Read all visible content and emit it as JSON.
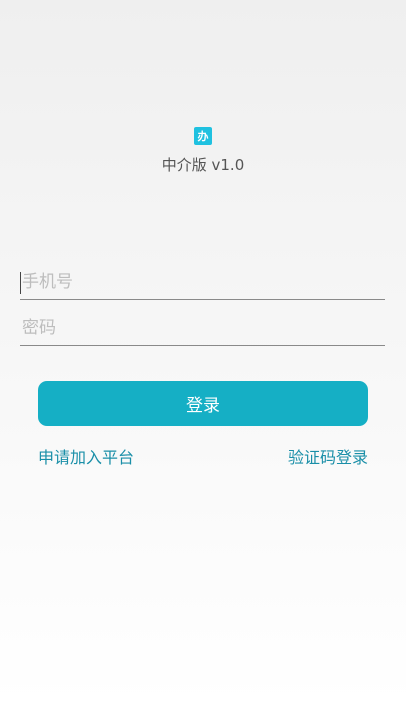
{
  "app": {
    "logo_glyph": "办",
    "title": "中介版 v1.0",
    "logo_color": "#1fc1e0"
  },
  "form": {
    "phone_placeholder": "手机号",
    "phone_value": "",
    "password_placeholder": "密码",
    "password_value": "",
    "login_label": "登录",
    "accent_color": "#15afc5"
  },
  "links": {
    "join_platform": "申请加入平台",
    "sms_login": "验证码登录",
    "link_color": "#1a8fa8"
  }
}
